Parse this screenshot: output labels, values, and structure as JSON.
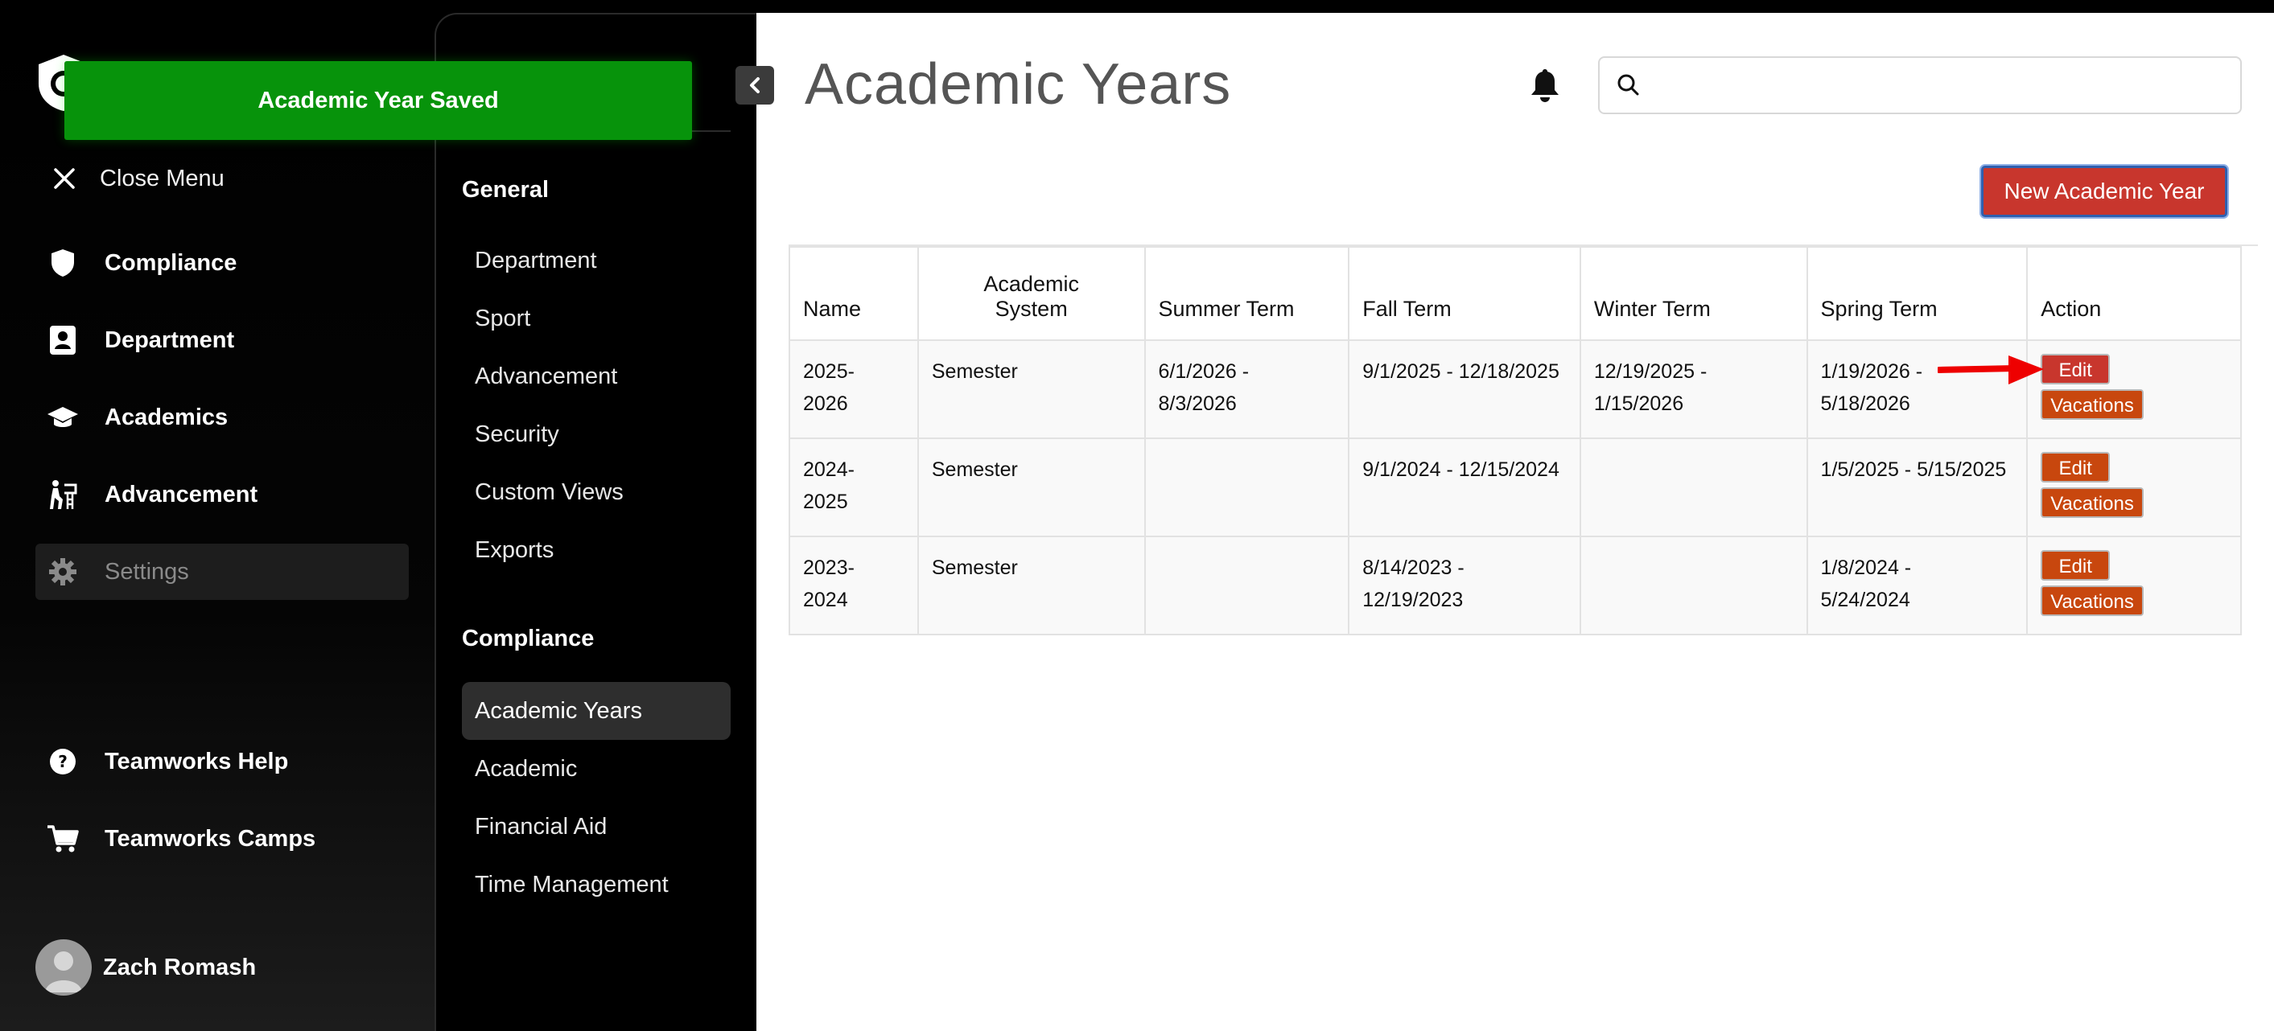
{
  "toast": {
    "message": "Academic Year Saved"
  },
  "sidebar": {
    "close_menu": "Close Menu",
    "items": [
      {
        "label": "Compliance",
        "icon": "shield-icon"
      },
      {
        "label": "Department",
        "icon": "id-card-icon"
      },
      {
        "label": "Academics",
        "icon": "graduation-cap-icon"
      },
      {
        "label": "Advancement",
        "icon": "person-climbing-icon"
      },
      {
        "label": "Settings",
        "icon": "gear-icon",
        "active": true
      }
    ],
    "help": [
      {
        "label": "Teamworks Help",
        "icon": "question-circle-icon"
      },
      {
        "label": "Teamworks Camps",
        "icon": "cart-icon"
      }
    ],
    "user": {
      "name": "Zach Romash"
    }
  },
  "panel": {
    "general": {
      "heading": "General",
      "items": [
        "Department",
        "Sport",
        "Advancement",
        "Security",
        "Custom Views",
        "Exports"
      ]
    },
    "compliance": {
      "heading": "Compliance",
      "items": [
        "Academic Years",
        "Academic",
        "Financial Aid",
        "Time Management"
      ],
      "active": "Academic Years"
    }
  },
  "main": {
    "title": "Academic Years",
    "search": {
      "placeholder": "",
      "value": ""
    },
    "new_button": "New Academic Year",
    "table": {
      "headers": {
        "name": "Name",
        "academic_system_1": "Academic",
        "academic_system_2": "System",
        "summer": "Summer Term",
        "fall": "Fall Term",
        "winter": "Winter Term",
        "spring": "Spring Term",
        "action": "Action"
      },
      "rows": [
        {
          "name1": "2025-",
          "name2": "2026",
          "system": "Semester",
          "summer1": "6/1/2026 -",
          "summer2": "8/3/2026",
          "fall1": "9/1/2025 - 12/18/2025",
          "fall2": "",
          "winter1": "12/19/2025 -",
          "winter2": "1/15/2026",
          "spring1": "1/19/2026 -",
          "spring2": "5/18/2026",
          "edit": "Edit",
          "vacations": "Vacations"
        },
        {
          "name1": "2024-",
          "name2": "2025",
          "system": "Semester",
          "summer1": "",
          "summer2": "",
          "fall1": "9/1/2024 - 12/15/2024",
          "fall2": "",
          "winter1": "",
          "winter2": "",
          "spring1": "1/5/2025 - 5/15/2025",
          "spring2": "",
          "edit": "Edit",
          "vacations": "Vacations"
        },
        {
          "name1": "2023-",
          "name2": "2024",
          "system": "Semester",
          "summer1": "",
          "summer2": "",
          "fall1": "8/14/2023 -",
          "fall2": "12/19/2023",
          "winter1": "",
          "winter2": "",
          "spring1": "1/8/2024 -",
          "spring2": "5/24/2024",
          "edit": "Edit",
          "vacations": "Vacations"
        }
      ]
    }
  },
  "colors": {
    "toast_green": "#07930b",
    "primary_red": "#c8362d",
    "action_orange": "#c8470e",
    "annotation_arrow": "#ee0000"
  }
}
